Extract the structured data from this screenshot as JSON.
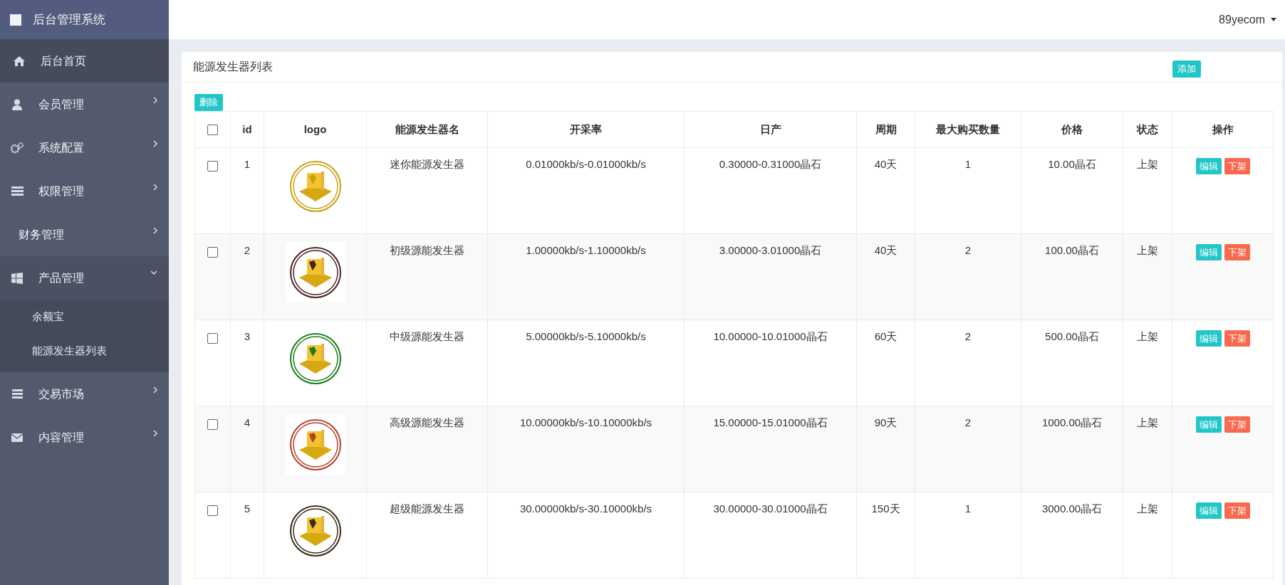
{
  "sidebar": {
    "title": "后台管理系统",
    "items": [
      {
        "label": "后台首页",
        "selected": true
      },
      {
        "label": "会员管理",
        "selected": false,
        "expanded": false
      },
      {
        "label": "系统配置",
        "selected": false,
        "expanded": false
      },
      {
        "label": "权限管理",
        "selected": false,
        "expanded": false
      },
      {
        "label": "财务管理",
        "selected": false,
        "expanded": false
      },
      {
        "label": "产品管理",
        "selected": false,
        "expanded": true,
        "children": [
          {
            "label": "余额宝",
            "selected": false
          },
          {
            "label": "能源发生器列表",
            "selected": false
          }
        ]
      },
      {
        "label": "交易市场",
        "selected": false,
        "expanded": false
      },
      {
        "label": "内容管理",
        "selected": false,
        "expanded": false
      }
    ]
  },
  "topbar": {
    "user": "89yecom"
  },
  "panel": {
    "title": "能源发生器列表",
    "add_button": "添加",
    "delete_button": "删除",
    "table": {
      "select_all_checked": false,
      "columns": [
        "id",
        "logo",
        "能源发生器名",
        "开采率",
        "日产",
        "周期",
        "最大购买数量",
        "价格",
        "状态",
        "操作"
      ],
      "rows": [
        {
          "checked": false,
          "id": "1",
          "color": "#c9a10e",
          "name": "迷你能源发生器",
          "rate": "0.01000kb/s-0.01000kb/s",
          "daily": "0.30000-0.31000晶石",
          "period": "40天",
          "max": "1",
          "price": "10.00晶石",
          "status": "上架",
          "actions": [
            "编辑",
            "下架"
          ]
        },
        {
          "checked": false,
          "id": "2",
          "color": "#4a2222",
          "name": "初级源能发生器",
          "rate": "1.00000kb/s-1.10000kb/s",
          "daily": "3.00000-3.01000晶石",
          "period": "40天",
          "max": "2",
          "price": "100.00晶石",
          "status": "上架",
          "actions": [
            "编辑",
            "下架"
          ]
        },
        {
          "checked": false,
          "id": "3",
          "color": "#1d7a1d",
          "name": "中级源能发生器",
          "rate": "5.00000kb/s-5.10000kb/s",
          "daily": "10.00000-10.01000晶石",
          "period": "60天",
          "max": "2",
          "price": "500.00晶石",
          "status": "上架",
          "actions": [
            "编辑",
            "下架"
          ]
        },
        {
          "checked": false,
          "id": "4",
          "color": "#b2412f",
          "name": "高级源能发生器",
          "rate": "10.00000kb/s-10.10000kb/s",
          "daily": "15.00000-15.01000晶石",
          "period": "90天",
          "max": "2",
          "price": "1000.00晶石",
          "status": "上架",
          "actions": [
            "编辑",
            "下架"
          ]
        },
        {
          "checked": false,
          "id": "5",
          "color": "#3a2a1a",
          "name": "超级能源发生器",
          "rate": "30.00000kb/s-30.10000kb/s",
          "daily": "30.00000-30.01000晶石",
          "period": "150天",
          "max": "1",
          "price": "3000.00晶石",
          "status": "上架",
          "actions": [
            "编辑",
            "下架"
          ]
        }
      ]
    }
  }
}
